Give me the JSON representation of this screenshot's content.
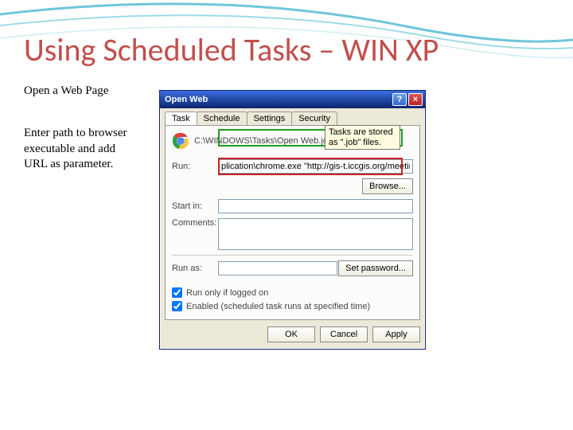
{
  "slide": {
    "title": "Using Scheduled Tasks – WIN XP",
    "text1": "Open a Web Page",
    "text2": "Enter path to browser\nexecutable and add\nURL as parameter.",
    "callout": "Tasks are stored as \".job\" files."
  },
  "dialog": {
    "title": "Open Web",
    "help_label": "?",
    "close_label": "×",
    "tabs": [
      "Task",
      "Schedule",
      "Settings",
      "Security"
    ],
    "task_path": "C:\\WINDOWS\\Tasks\\Open Web.job",
    "run_label": "Run:",
    "run_value": "plication\\chrome.exe \"http://gis-t.iccgis.org/meetings.asp\"",
    "browse_label": "Browse...",
    "startin_label": "Start in:",
    "startin_value": "",
    "comments_label": "Comments:",
    "comments_value": "",
    "runas_label": "Run as:",
    "runas_value": "",
    "setpassword_label": "Set password...",
    "check1": "Run only if logged on",
    "check2": "Enabled (scheduled task runs at specified time)",
    "ok_label": "OK",
    "cancel_label": "Cancel",
    "apply_label": "Apply"
  }
}
